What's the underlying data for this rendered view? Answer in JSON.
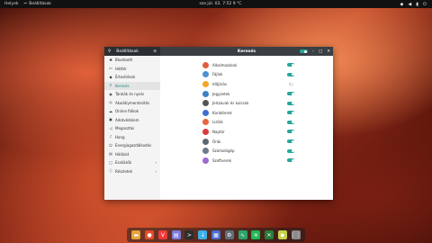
{
  "topbar": {
    "activities": "Helyek",
    "app_name": "Beállítások",
    "clock": "szo júl. 03. 7:52",
    "weather": "9 °C"
  },
  "window": {
    "sidebar_title": "Beállítások",
    "main_title": "Keresés",
    "sidebar": [
      {
        "label": "Bluetooth",
        "icon": "bluetooth-icon",
        "glyph": "✱"
      },
      {
        "label": "Háttér",
        "icon": "background-icon",
        "glyph": "▭"
      },
      {
        "label": "Értesítések",
        "icon": "bell-icon",
        "glyph": "◆"
      },
      {
        "label": "Keresés",
        "icon": "search-icon",
        "glyph": "⚲",
        "active": true
      },
      {
        "label": "Tárolók és nyelv",
        "icon": "region-icon",
        "glyph": "◉"
      },
      {
        "label": "Akadálymentesítés",
        "icon": "accessibility-icon",
        "glyph": "◎"
      },
      {
        "label": "Online fiókok",
        "icon": "online-accounts-icon",
        "glyph": "☁"
      },
      {
        "label": "Adatvédelem",
        "icon": "privacy-icon",
        "glyph": "▣"
      },
      {
        "label": "Megosztás",
        "icon": "sharing-icon",
        "glyph": "◁"
      },
      {
        "label": "Hang",
        "icon": "sound-icon",
        "glyph": "♪"
      },
      {
        "label": "Energiagazdálkodás",
        "icon": "power-icon",
        "glyph": "⏻"
      },
      {
        "label": "Hálózat",
        "icon": "network-icon",
        "glyph": "▤"
      },
      {
        "label": "Eszközök",
        "icon": "devices-icon",
        "glyph": "▢",
        "arrow": "›"
      },
      {
        "label": "Részletek",
        "icon": "details-icon",
        "glyph": "ⓘ",
        "arrow": "›"
      }
    ],
    "search_items": [
      {
        "label": "Alkalmazások",
        "color": "#e25d3a",
        "on": true
      },
      {
        "label": "Fájlok",
        "color": "#4f8fd6",
        "on": true
      },
      {
        "label": "Időjárás",
        "color": "#f5a623",
        "on": false
      },
      {
        "label": "Jegyzetek",
        "color": "#3b82c4",
        "on": true
      },
      {
        "label": "Jelszavak és kulcsok",
        "color": "#555555",
        "on": true
      },
      {
        "label": "Karakterek",
        "color": "#3d6fd1",
        "on": true
      },
      {
        "label": "Listák",
        "color": "#e8663b",
        "on": true
      },
      {
        "label": "Naptár",
        "color": "#d93b3b",
        "on": true
      },
      {
        "label": "Órák",
        "color": "#5b6770",
        "on": true
      },
      {
        "label": "Számológép",
        "color": "#6c7a89",
        "on": true
      },
      {
        "label": "Szoftverek",
        "color": "#9a6ad1",
        "on": true
      }
    ],
    "off_mark": "I○"
  },
  "dock": [
    {
      "name": "files-icon",
      "color": "#e6a43a",
      "glyph": "▬"
    },
    {
      "name": "firefox-icon",
      "color": "#e44d26",
      "glyph": "●"
    },
    {
      "name": "vivaldi-icon",
      "color": "#ef3939",
      "glyph": "V"
    },
    {
      "name": "editor-icon",
      "color": "#7c7cde",
      "glyph": "▤"
    },
    {
      "name": "terminal-icon",
      "color": "#2d2d2d",
      "glyph": ">"
    },
    {
      "name": "update-icon",
      "color": "#3db0e6",
      "glyph": "↓"
    },
    {
      "name": "calendar-icon",
      "color": "#4b6cd1",
      "glyph": "▦"
    },
    {
      "name": "settings-icon",
      "color": "#5f6e7d",
      "glyph": "⚙"
    },
    {
      "name": "monitor-icon",
      "color": "#2ba36b",
      "glyph": "∿"
    },
    {
      "name": "spotify-icon",
      "color": "#1db954",
      "glyph": "≋"
    },
    {
      "name": "xbox-icon",
      "color": "#2a7d3a",
      "glyph": "✕"
    },
    {
      "name": "software-icon",
      "color": "#c9d34a",
      "glyph": "◆"
    },
    {
      "name": "app-grid-icon",
      "color": "#8a8a8a",
      "glyph": "⋮⋮"
    }
  ]
}
